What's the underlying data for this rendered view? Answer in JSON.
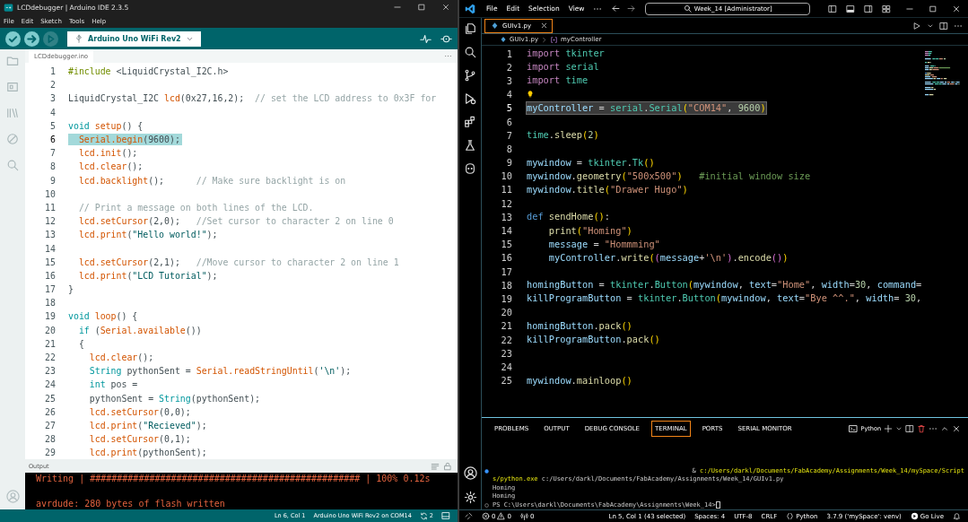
{
  "arduino": {
    "window_title": "LCDdebugger | Arduino IDE 2.3.5",
    "menu": [
      "File",
      "Edit",
      "Sketch",
      "Tools",
      "Help"
    ],
    "toolbar": [
      {
        "kind": "verify",
        "disabled": false
      },
      {
        "kind": "upload",
        "disabled": false
      },
      {
        "kind": "debug",
        "disabled": true
      }
    ],
    "board": "Arduino Uno WiFi Rev2",
    "tab": "LCDdebugger.ino",
    "code": [
      {
        "num": "1",
        "selected": false,
        "segs": [
          {
            "kind": "pre",
            "text": "#include"
          },
          {
            "kind": "txt",
            "text": " <LiquidCrystal_I2C.h>"
          }
        ]
      },
      {
        "num": "2",
        "selected": false
      },
      {
        "num": "3",
        "selected": false,
        "segs": [
          {
            "kind": "txt",
            "text": "LiquidCrystal_I2C "
          },
          {
            "kind": "fn",
            "text": "lcd"
          },
          {
            "kind": "txt",
            "text": "(0x27,16,2);  "
          },
          {
            "kind": "com",
            "text": "// set the LCD address to 0x3F for"
          }
        ]
      },
      {
        "num": "4",
        "selected": false
      },
      {
        "num": "5",
        "selected": false,
        "segs": [
          {
            "kind": "kw",
            "text": "void "
          },
          {
            "kind": "fn",
            "text": "setup"
          },
          {
            "kind": "txt",
            "text": "() {"
          }
        ]
      },
      {
        "num": "6",
        "selected": true,
        "segs": [
          {
            "kind": "fn",
            "text": "  Serial.begin"
          },
          {
            "kind": "txt",
            "text": "(9600);"
          }
        ]
      },
      {
        "num": "7",
        "selected": false,
        "segs": [
          {
            "kind": "fn",
            "text": "  lcd.init"
          },
          {
            "kind": "txt",
            "text": "();"
          }
        ]
      },
      {
        "num": "8",
        "selected": false,
        "segs": [
          {
            "kind": "fn",
            "text": "  lcd.clear"
          },
          {
            "kind": "txt",
            "text": "();"
          }
        ]
      },
      {
        "num": "9",
        "selected": false,
        "segs": [
          {
            "kind": "fn",
            "text": "  lcd.backlight"
          },
          {
            "kind": "txt",
            "text": "();      "
          },
          {
            "kind": "com",
            "text": "// Make sure backlight is on"
          }
        ]
      },
      {
        "num": "10",
        "selected": false
      },
      {
        "num": "11",
        "selected": false,
        "segs": [
          {
            "kind": "com",
            "text": "  // Print a message on both lines of the LCD."
          }
        ]
      },
      {
        "num": "12",
        "selected": false,
        "segs": [
          {
            "kind": "fn",
            "text": "  lcd.setCursor"
          },
          {
            "kind": "txt",
            "text": "(2,0);   "
          },
          {
            "kind": "com",
            "text": "//Set cursor to character 2 on line 0"
          }
        ]
      },
      {
        "num": "13",
        "selected": false,
        "segs": [
          {
            "kind": "fn",
            "text": "  lcd.print"
          },
          {
            "kind": "txt",
            "text": "("
          },
          {
            "kind": "str",
            "text": "\"Hello world!\""
          },
          {
            "kind": "txt",
            "text": ");"
          }
        ]
      },
      {
        "num": "14",
        "selected": false
      },
      {
        "num": "15",
        "selected": false,
        "segs": [
          {
            "kind": "fn",
            "text": "  lcd.setCursor"
          },
          {
            "kind": "txt",
            "text": "(2,1);   "
          },
          {
            "kind": "com",
            "text": "//Move cursor to character 2 on line 1"
          }
        ]
      },
      {
        "num": "16",
        "selected": false,
        "segs": [
          {
            "kind": "fn",
            "text": "  lcd.print"
          },
          {
            "kind": "txt",
            "text": "("
          },
          {
            "kind": "str",
            "text": "\"LCD Tutorial\""
          },
          {
            "kind": "txt",
            "text": ");"
          }
        ]
      },
      {
        "num": "17",
        "selected": false,
        "segs": [
          {
            "kind": "txt",
            "text": "}"
          }
        ]
      },
      {
        "num": "18",
        "selected": false
      },
      {
        "num": "19",
        "selected": false,
        "segs": [
          {
            "kind": "kw",
            "text": "void "
          },
          {
            "kind": "fn",
            "text": "loop"
          },
          {
            "kind": "txt",
            "text": "() {"
          }
        ]
      },
      {
        "num": "20",
        "selected": false,
        "segs": [
          {
            "kind": "kw",
            "text": "  if"
          },
          {
            "kind": "txt",
            "text": " ("
          },
          {
            "kind": "fn",
            "text": "Serial.available"
          },
          {
            "kind": "txt",
            "text": "())"
          }
        ]
      },
      {
        "num": "21",
        "selected": false,
        "segs": [
          {
            "kind": "txt",
            "text": "  {"
          }
        ]
      },
      {
        "num": "22",
        "selected": false,
        "segs": [
          {
            "kind": "fn",
            "text": "    lcd.clear"
          },
          {
            "kind": "txt",
            "text": "();"
          }
        ]
      },
      {
        "num": "23",
        "selected": false,
        "segs": [
          {
            "kind": "kw",
            "text": "    String"
          },
          {
            "kind": "txt",
            "text": " pythonSent = "
          },
          {
            "kind": "fn",
            "text": "Serial.readStringUntil"
          },
          {
            "kind": "txt",
            "text": "("
          },
          {
            "kind": "str",
            "text": "'\\n'"
          },
          {
            "kind": "txt",
            "text": ");"
          }
        ]
      },
      {
        "num": "24",
        "selected": false,
        "segs": [
          {
            "kind": "kw",
            "text": "    int"
          },
          {
            "kind": "txt",
            "text": " pos ="
          }
        ]
      },
      {
        "num": "25",
        "selected": false,
        "segs": [
          {
            "kind": "txt",
            "text": "    pythonSent = "
          },
          {
            "kind": "kw",
            "text": "String"
          },
          {
            "kind": "txt",
            "text": "(pythonSent);"
          }
        ]
      },
      {
        "num": "26",
        "selected": false,
        "segs": [
          {
            "kind": "fn",
            "text": "    lcd.setCursor"
          },
          {
            "kind": "txt",
            "text": "(0,0);"
          }
        ]
      },
      {
        "num": "27",
        "selected": false,
        "segs": [
          {
            "kind": "fn",
            "text": "    lcd.print"
          },
          {
            "kind": "txt",
            "text": "("
          },
          {
            "kind": "str",
            "text": "\"Recieved\""
          },
          {
            "kind": "txt",
            "text": ");"
          }
        ]
      },
      {
        "num": "28",
        "selected": false,
        "segs": [
          {
            "kind": "fn",
            "text": "    lcd.setCursor"
          },
          {
            "kind": "txt",
            "text": "(0,1);"
          }
        ]
      },
      {
        "num": "29",
        "selected": false,
        "segs": [
          {
            "kind": "fn",
            "text": "    lcd.print"
          },
          {
            "kind": "txt",
            "text": "(pythonSent);"
          }
        ]
      }
    ],
    "output_title": "Output",
    "output": [
      "Writing | ################################################## | 100% 0.12s",
      "avrdude: 280 bytes of flash written"
    ],
    "status": {
      "position": "Ln 6, Col 1",
      "board": "Arduino Uno WiFi Rev2 on COM14",
      "notifications": "2"
    }
  },
  "vscode": {
    "menu": [
      "File",
      "Edit",
      "Selection",
      "View"
    ],
    "search": "Week_14 [Administrator]",
    "tab": {
      "label": "GUIv1.py",
      "selected": true
    },
    "breadcrumbs": [
      "GUIv1.py",
      "myController"
    ],
    "code": [
      {
        "num": "1",
        "selected": false,
        "bulb": false,
        "segs": [
          {
            "kind": "kw",
            "text": "import "
          },
          {
            "kind": "cls",
            "text": "tkinter"
          }
        ]
      },
      {
        "num": "2",
        "selected": false,
        "bulb": false,
        "segs": [
          {
            "kind": "kw",
            "text": "import "
          },
          {
            "kind": "cls",
            "text": "serial"
          }
        ]
      },
      {
        "num": "3",
        "selected": false,
        "bulb": false,
        "segs": [
          {
            "kind": "kw",
            "text": "import "
          },
          {
            "kind": "cls",
            "text": "time"
          }
        ]
      },
      {
        "num": "4",
        "selected": false,
        "bulb": true
      },
      {
        "num": "5",
        "selected": true,
        "bulb": false,
        "segs": [
          {
            "kind": "var",
            "text": "myController"
          },
          {
            "kind": "txt",
            "text": " = "
          },
          {
            "kind": "cls",
            "text": "serial"
          },
          {
            "kind": "txt",
            "text": "."
          },
          {
            "kind": "cls",
            "text": "Serial"
          },
          {
            "kind": "br1",
            "text": "("
          },
          {
            "kind": "str",
            "text": "\"COM14\""
          },
          {
            "kind": "txt",
            "text": ", "
          },
          {
            "kind": "num",
            "text": "9600"
          },
          {
            "kind": "br1",
            "text": ")"
          }
        ]
      },
      {
        "num": "6",
        "selected": false,
        "bulb": false
      },
      {
        "num": "7",
        "selected": false,
        "bulb": false,
        "segs": [
          {
            "kind": "cls",
            "text": "time"
          },
          {
            "kind": "txt",
            "text": "."
          },
          {
            "kind": "fn",
            "text": "sleep"
          },
          {
            "kind": "br1",
            "text": "("
          },
          {
            "kind": "num",
            "text": "2"
          },
          {
            "kind": "br1",
            "text": ")"
          }
        ]
      },
      {
        "num": "8",
        "selected": false,
        "bulb": false
      },
      {
        "num": "9",
        "selected": false,
        "bulb": false,
        "segs": [
          {
            "kind": "var",
            "text": "mywindow"
          },
          {
            "kind": "txt",
            "text": " = "
          },
          {
            "kind": "cls",
            "text": "tkinter"
          },
          {
            "kind": "txt",
            "text": "."
          },
          {
            "kind": "cls",
            "text": "Tk"
          },
          {
            "kind": "br1",
            "text": "()"
          }
        ]
      },
      {
        "num": "10",
        "selected": false,
        "bulb": false,
        "segs": [
          {
            "kind": "var",
            "text": "mywindow"
          },
          {
            "kind": "txt",
            "text": "."
          },
          {
            "kind": "fn",
            "text": "geometry"
          },
          {
            "kind": "br1",
            "text": "("
          },
          {
            "kind": "str",
            "text": "\"500x500\""
          },
          {
            "kind": "br1",
            "text": ")"
          },
          {
            "kind": "com",
            "text": "   #initial window size"
          }
        ]
      },
      {
        "num": "11",
        "selected": false,
        "bulb": false,
        "segs": [
          {
            "kind": "var",
            "text": "mywindow"
          },
          {
            "kind": "txt",
            "text": "."
          },
          {
            "kind": "fn",
            "text": "title"
          },
          {
            "kind": "br1",
            "text": "("
          },
          {
            "kind": "str",
            "text": "\"Drawer Hugo\""
          },
          {
            "kind": "br1",
            "text": ")"
          }
        ]
      },
      {
        "num": "12",
        "selected": false,
        "bulb": false
      },
      {
        "num": "13",
        "selected": false,
        "bulb": false,
        "segs": [
          {
            "kind": "def",
            "text": "def "
          },
          {
            "kind": "fn",
            "text": "sendHome"
          },
          {
            "kind": "br1",
            "text": "()"
          },
          {
            "kind": "txt",
            "text": ":"
          }
        ]
      },
      {
        "num": "14",
        "selected": false,
        "bulb": false,
        "segs": [
          {
            "kind": "fn",
            "text": "    print"
          },
          {
            "kind": "br1",
            "text": "("
          },
          {
            "kind": "str",
            "text": "\"Homing\""
          },
          {
            "kind": "br1",
            "text": ")"
          }
        ]
      },
      {
        "num": "15",
        "selected": false,
        "bulb": false,
        "segs": [
          {
            "kind": "var",
            "text": "    message"
          },
          {
            "kind": "txt",
            "text": " = "
          },
          {
            "kind": "str",
            "text": "\"Hommming\""
          }
        ]
      },
      {
        "num": "16",
        "selected": false,
        "bulb": false,
        "segs": [
          {
            "kind": "var",
            "text": "    myController"
          },
          {
            "kind": "txt",
            "text": "."
          },
          {
            "kind": "fn",
            "text": "write"
          },
          {
            "kind": "br1",
            "text": "("
          },
          {
            "kind": "br2",
            "text": "("
          },
          {
            "kind": "var",
            "text": "message"
          },
          {
            "kind": "txt",
            "text": "+"
          },
          {
            "kind": "str",
            "text": "'\\n'"
          },
          {
            "kind": "br2",
            "text": ")"
          },
          {
            "kind": "txt",
            "text": "."
          },
          {
            "kind": "fn",
            "text": "encode"
          },
          {
            "kind": "br2",
            "text": "()"
          },
          {
            "kind": "br1",
            "text": ")"
          }
        ]
      },
      {
        "num": "17",
        "selected": false,
        "bulb": false
      },
      {
        "num": "18",
        "selected": false,
        "bulb": false,
        "segs": [
          {
            "kind": "var",
            "text": "homingButton"
          },
          {
            "kind": "txt",
            "text": " = "
          },
          {
            "kind": "cls",
            "text": "tkinter"
          },
          {
            "kind": "txt",
            "text": "."
          },
          {
            "kind": "cls",
            "text": "Button"
          },
          {
            "kind": "br1",
            "text": "("
          },
          {
            "kind": "var",
            "text": "mywindow"
          },
          {
            "kind": "txt",
            "text": ", "
          },
          {
            "kind": "var",
            "text": "text"
          },
          {
            "kind": "txt",
            "text": "="
          },
          {
            "kind": "str",
            "text": "\"Home\""
          },
          {
            "kind": "txt",
            "text": ", "
          },
          {
            "kind": "var",
            "text": "width"
          },
          {
            "kind": "txt",
            "text": "="
          },
          {
            "kind": "num",
            "text": "30"
          },
          {
            "kind": "txt",
            "text": ", "
          },
          {
            "kind": "var",
            "text": "command"
          },
          {
            "kind": "txt",
            "text": "="
          }
        ]
      },
      {
        "num": "19",
        "selected": false,
        "bulb": false,
        "segs": [
          {
            "kind": "var",
            "text": "killProgramButton"
          },
          {
            "kind": "txt",
            "text": " = "
          },
          {
            "kind": "cls",
            "text": "tkinter"
          },
          {
            "kind": "txt",
            "text": "."
          },
          {
            "kind": "cls",
            "text": "Button"
          },
          {
            "kind": "br1",
            "text": "("
          },
          {
            "kind": "var",
            "text": "mywindow"
          },
          {
            "kind": "txt",
            "text": ", "
          },
          {
            "kind": "var",
            "text": "text"
          },
          {
            "kind": "txt",
            "text": "="
          },
          {
            "kind": "str",
            "text": "\"Bye ^^.\""
          },
          {
            "kind": "txt",
            "text": ", "
          },
          {
            "kind": "var",
            "text": "width"
          },
          {
            "kind": "txt",
            "text": "= "
          },
          {
            "kind": "num",
            "text": "30"
          },
          {
            "kind": "txt",
            "text": ","
          }
        ]
      },
      {
        "num": "20",
        "selected": false,
        "bulb": false
      },
      {
        "num": "21",
        "selected": false,
        "bulb": false,
        "segs": [
          {
            "kind": "var",
            "text": "homingButton"
          },
          {
            "kind": "txt",
            "text": "."
          },
          {
            "kind": "fn",
            "text": "pack"
          },
          {
            "kind": "br1",
            "text": "()"
          }
        ]
      },
      {
        "num": "22",
        "selected": false,
        "bulb": false,
        "segs": [
          {
            "kind": "var",
            "text": "killProgramButton"
          },
          {
            "kind": "txt",
            "text": "."
          },
          {
            "kind": "fn",
            "text": "pack"
          },
          {
            "kind": "br1",
            "text": "()"
          }
        ]
      },
      {
        "num": "23",
        "selected": false,
        "bulb": false
      },
      {
        "num": "24",
        "selected": false,
        "bulb": false
      },
      {
        "num": "25",
        "selected": false,
        "bulb": false,
        "segs": [
          {
            "kind": "var",
            "text": "mywindow"
          },
          {
            "kind": "txt",
            "text": "."
          },
          {
            "kind": "fn",
            "text": "mainloop"
          },
          {
            "kind": "br1",
            "text": "()"
          }
        ]
      }
    ],
    "panel_tabs": [
      {
        "label": "PROBLEMS",
        "selected": false
      },
      {
        "label": "OUTPUT",
        "selected": false
      },
      {
        "label": "DEBUG CONSOLE",
        "selected": false
      },
      {
        "label": "TERMINAL",
        "selected": true
      },
      {
        "label": "PORTS",
        "selected": false
      },
      {
        "label": "SERIAL MONITOR",
        "selected": false
      }
    ],
    "terminal_profile": "Python",
    "terminal": [
      {
        "kind": "command",
        "segs": [
          {
            "kind": "txt",
            "text": "& "
          },
          {
            "kind": "path",
            "text": "c:/Users/darkl/Documents/FabAcademy/Assignments/Week_14/mySpace/Script"
          }
        ]
      },
      {
        "kind": "wrap",
        "segs": [
          {
            "kind": "path",
            "text": "s/python.exe"
          },
          {
            "kind": "txt",
            "text": " c:/Users/darkl/Documents/FabAcademy/Assignments/Week_14/GUIv1.py"
          }
        ]
      },
      {
        "kind": "output",
        "segs": [
          {
            "kind": "txt",
            "text": "Homing"
          }
        ]
      },
      {
        "kind": "output",
        "segs": [
          {
            "kind": "txt",
            "text": "Homing"
          }
        ]
      },
      {
        "kind": "prompt",
        "segs": [
          {
            "kind": "txt",
            "text": "PS C:\\Users\\darkl\\Documents\\FabAcademy\\Assignments\\Week_14>"
          }
        ]
      }
    ],
    "status": {
      "errors": "0",
      "warnings": "0",
      "ports": "0",
      "items": [
        {
          "kind": "text",
          "text": "Ln 5, Col 1 (43 selected)"
        },
        {
          "kind": "text",
          "text": "Spaces: 4"
        },
        {
          "kind": "text",
          "text": "UTF-8"
        },
        {
          "kind": "text",
          "text": "CRLF"
        },
        {
          "kind": "language",
          "text": "Python"
        },
        {
          "kind": "text",
          "text": "3.7.9 ('mySpace': venv)"
        },
        {
          "kind": "live",
          "text": "Go Live"
        }
      ]
    }
  }
}
